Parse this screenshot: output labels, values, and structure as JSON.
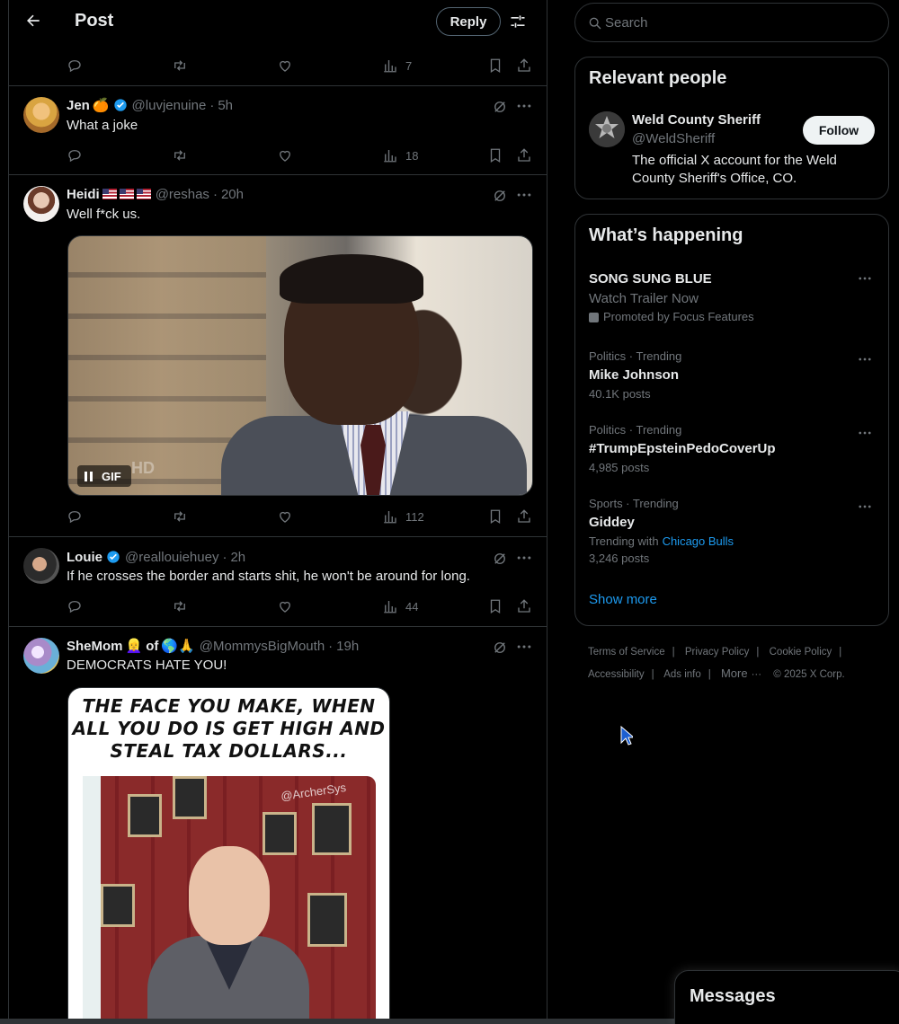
{
  "header": {
    "title": "Post",
    "reply_label": "Reply"
  },
  "first_row": {
    "views": "7"
  },
  "tweets": [
    {
      "name": "Jen",
      "emoji": "🍊",
      "handle": "@luvjenuine",
      "time": "5h",
      "text": "What a joke",
      "views": "18"
    },
    {
      "name": "Heidi",
      "handle": "@reshas",
      "time": "20h",
      "text": "Well f*ck us.",
      "views": "112",
      "gif_label": "GIF",
      "gif_watermark": "HD"
    },
    {
      "name": "Louie",
      "handle": "@reallouiehuey",
      "time": "2h",
      "text": "If he crosses the border and starts shit, he won't be around for long.",
      "views": "44"
    },
    {
      "name": "SheMom",
      "name_suffix": "of",
      "emoji1": "👱‍♀️",
      "emoji2": "🌎🙏",
      "handle": "@MommysBigMouth",
      "time": "19h",
      "text": "DEMOCRATS HATE YOU!",
      "meme_caption": "THE FACE YOU MAKE, WHEN ALL YOU DO IS GET HIGH AND STEAL TAX DOLLARS...",
      "meme_watermark": "@ArcherSys"
    }
  ],
  "search": {
    "placeholder": "Search"
  },
  "relevant_people": {
    "title": "Relevant people",
    "name": "Weld County Sheriff",
    "handle": "@WeldSheriff",
    "bio": "The official X account for the Weld County Sheriff's Office, CO.",
    "follow_label": "Follow"
  },
  "whats_happening": {
    "title": "What’s happening",
    "promo": {
      "name": "SONG SUNG BLUE",
      "sub": "Watch Trailer Now",
      "promoted": "Promoted by Focus Features"
    },
    "trends": [
      {
        "meta": "Politics · Trending",
        "name": "Mike Johnson",
        "count": "40.1K posts"
      },
      {
        "meta": "Politics · Trending",
        "name": "#TrumpEpsteinPedoCoverUp",
        "count": "4,985 posts"
      },
      {
        "meta": "Sports · Trending",
        "name": "Giddey",
        "with_label": "Trending with",
        "with_link": "Chicago Bulls",
        "count": "3,246 posts"
      }
    ],
    "show_more": "Show more"
  },
  "footer": {
    "terms": "Terms of Service",
    "privacy": "Privacy Policy",
    "cookie": "Cookie Policy",
    "accessibility": "Accessibility",
    "ads": "Ads info",
    "more": "More",
    "copyright": "© 2025 X Corp."
  },
  "messages": {
    "title": "Messages"
  },
  "colors": {
    "background": "#000000",
    "text": "#e7e9ea",
    "muted": "#71767b",
    "accent": "#1d9bf0",
    "border": "#2f3336"
  }
}
